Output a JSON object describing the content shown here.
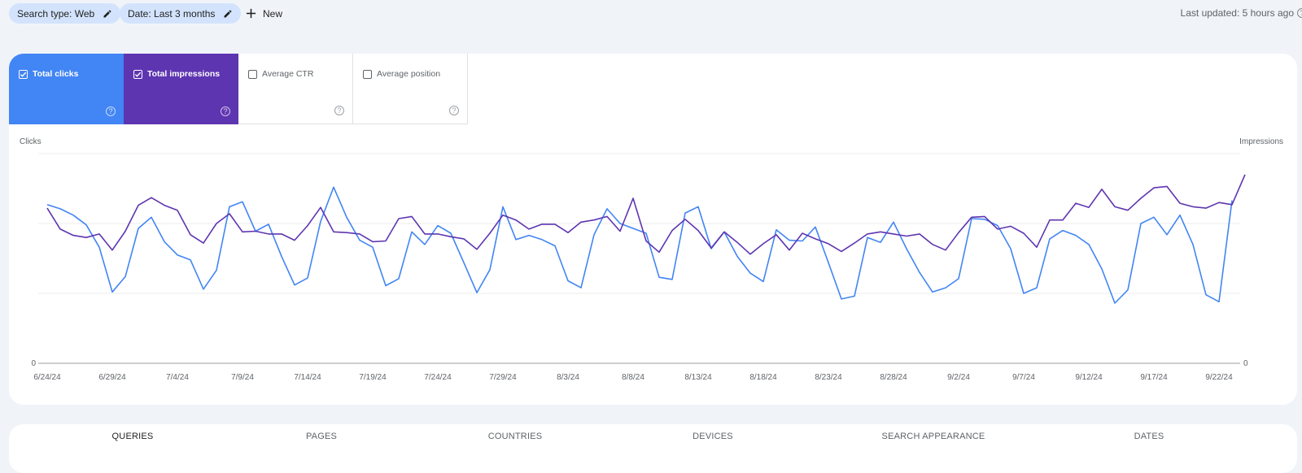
{
  "filters": {
    "chips": [
      {
        "label": "Search type: Web",
        "icon": "pencil-icon"
      },
      {
        "label": "Date: Last 3 months",
        "icon": "pencil-icon"
      }
    ],
    "new_label": "New",
    "last_updated": "Last updated: 5 hours ago"
  },
  "metrics": [
    {
      "label": "Total clicks",
      "checked": true,
      "color": "#4285f4"
    },
    {
      "label": "Total impressions",
      "checked": true,
      "color": "#5e35b1"
    },
    {
      "label": "Average CTR",
      "checked": false
    },
    {
      "label": "Average position",
      "checked": false
    }
  ],
  "chart_data": {
    "type": "line",
    "title": "",
    "ylabel_left": "Clicks",
    "ylabel_right": "Impressions",
    "xlabel": "",
    "y_tick_left": "0",
    "y_tick_right": "0",
    "ylim_relative": [
      0,
      3.0
    ],
    "grid": true,
    "x_start": "6/24/24",
    "x_ticks": [
      "6/24/24",
      "6/29/24",
      "7/4/24",
      "7/9/24",
      "7/14/24",
      "7/19/24",
      "7/24/24",
      "7/29/24",
      "8/3/24",
      "8/8/24",
      "8/13/24",
      "8/18/24",
      "8/23/24",
      "8/28/24",
      "9/2/24",
      "9/7/24",
      "9/12/24",
      "9/17/24",
      "9/22/24"
    ],
    "tick_every_days": 5,
    "note": "Y-axis values are hidden in the UI; series are in relative gridline units (gridlines at 1, 2, 3).",
    "series": [
      {
        "name": "Clicks",
        "color": "#4285f4",
        "axis": "left",
        "values": [
          2.27,
          2.21,
          2.12,
          1.98,
          1.66,
          1.02,
          1.24,
          1.93,
          2.09,
          1.74,
          1.55,
          1.48,
          1.06,
          1.33,
          2.24,
          2.31,
          1.89,
          1.99,
          1.53,
          1.12,
          1.22,
          2.03,
          2.52,
          2.09,
          1.76,
          1.66,
          1.11,
          1.21,
          1.88,
          1.7,
          1.97,
          1.86,
          1.44,
          1.01,
          1.34,
          2.24,
          1.77,
          1.83,
          1.77,
          1.68,
          1.18,
          1.08,
          1.84,
          2.21,
          2.0,
          1.93,
          1.86,
          1.23,
          1.2,
          2.15,
          2.24,
          1.64,
          1.88,
          1.53,
          1.29,
          1.17,
          1.91,
          1.76,
          1.75,
          1.95,
          1.44,
          0.92,
          0.96,
          1.8,
          1.73,
          2.02,
          1.64,
          1.3,
          1.02,
          1.08,
          1.21,
          2.07,
          2.06,
          1.97,
          1.64,
          1.0,
          1.08,
          1.78,
          1.9,
          1.83,
          1.7,
          1.35,
          0.86,
          1.05,
          2.0,
          2.09,
          1.84,
          2.12,
          1.7,
          0.98,
          0.88,
          2.33
        ]
      },
      {
        "name": "Impressions",
        "color": "#5e35b1",
        "axis": "right",
        "values": [
          2.22,
          1.92,
          1.83,
          1.8,
          1.85,
          1.62,
          1.89,
          2.26,
          2.37,
          2.26,
          2.19,
          1.84,
          1.72,
          2.0,
          2.14,
          1.88,
          1.89,
          1.85,
          1.85,
          1.76,
          1.97,
          2.23,
          1.88,
          1.87,
          1.85,
          1.74,
          1.75,
          2.07,
          2.1,
          1.85,
          1.85,
          1.81,
          1.78,
          1.63,
          1.86,
          2.12,
          2.05,
          1.92,
          1.99,
          1.99,
          1.87,
          2.02,
          2.05,
          2.1,
          1.89,
          2.36,
          1.75,
          1.59,
          1.9,
          2.06,
          1.9,
          1.65,
          1.88,
          1.73,
          1.56,
          1.71,
          1.84,
          1.62,
          1.86,
          1.78,
          1.71,
          1.6,
          1.72,
          1.85,
          1.88,
          1.85,
          1.82,
          1.85,
          1.7,
          1.62,
          1.87,
          2.09,
          2.1,
          1.92,
          1.96,
          1.86,
          1.66,
          2.05,
          2.05,
          2.29,
          2.23,
          2.49,
          2.24,
          2.19,
          2.36,
          2.51,
          2.53,
          2.29,
          2.24,
          2.22,
          2.3,
          2.27,
          2.7
        ]
      }
    ]
  },
  "tabs": [
    {
      "label": "QUERIES",
      "active": true
    },
    {
      "label": "PAGES",
      "active": false
    },
    {
      "label": "COUNTRIES",
      "active": false
    },
    {
      "label": "DEVICES",
      "active": false
    },
    {
      "label": "SEARCH APPEARANCE",
      "active": false
    },
    {
      "label": "DATES",
      "active": false
    }
  ]
}
